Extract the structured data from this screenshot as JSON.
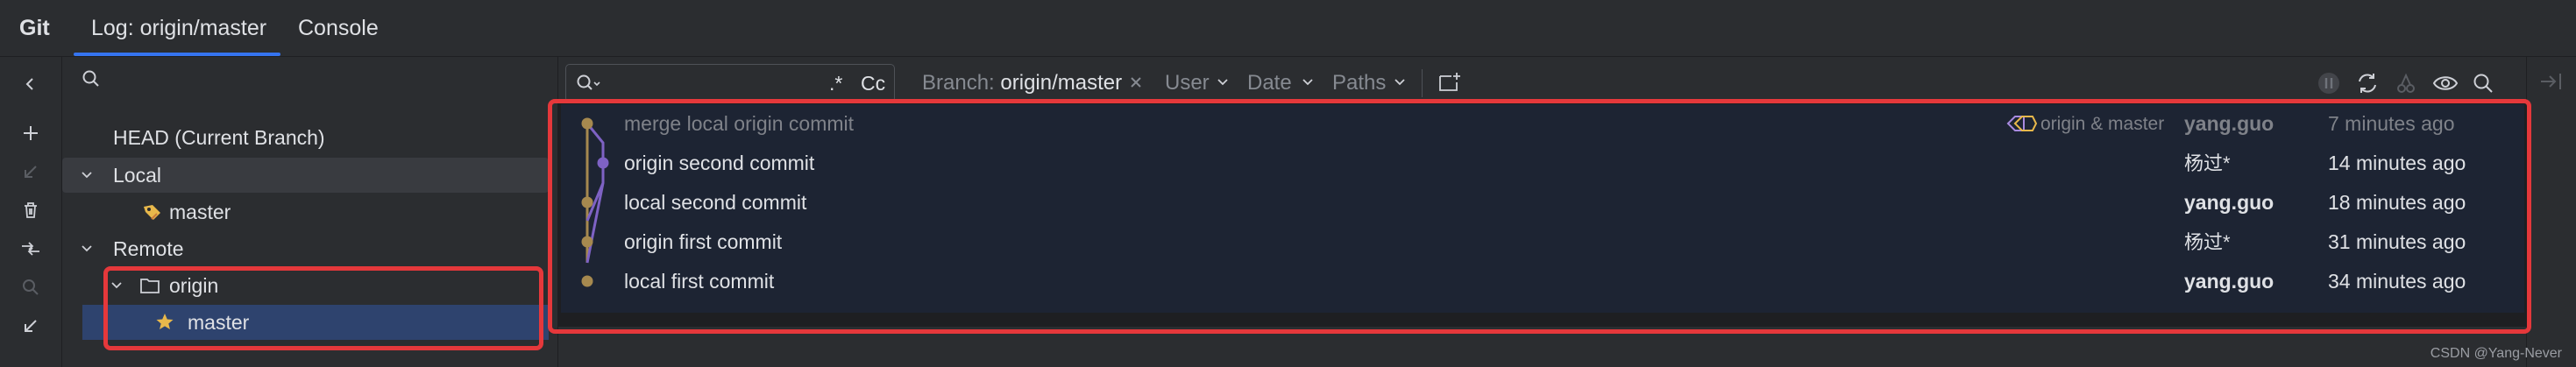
{
  "tabs": [
    {
      "label": "Git"
    },
    {
      "label": "Log: origin/master"
    },
    {
      "label": "Console"
    }
  ],
  "branches": {
    "head": "HEAD (Current Branch)",
    "local_group": "Local",
    "local_master": "master",
    "remote_group": "Remote",
    "remote_origin": "origin",
    "remote_master": "master"
  },
  "filters": {
    "regex": ".*",
    "case": "Cc",
    "branch_prefix": "Branch:",
    "branch_value": "origin/master",
    "user": "User",
    "date": "Date",
    "paths": "Paths"
  },
  "commits": [
    {
      "subject": "merge local origin commit",
      "refs": "origin & master",
      "author": "yang.guo",
      "date": "7 minutes ago"
    },
    {
      "subject": "origin second commit",
      "refs": "",
      "author": "杨过*",
      "date": "14 minutes ago"
    },
    {
      "subject": "local second commit",
      "refs": "",
      "author": "yang.guo",
      "date": "18 minutes ago"
    },
    {
      "subject": "origin first commit",
      "refs": "",
      "author": "杨过*",
      "date": "31 minutes ago"
    },
    {
      "subject": "local first commit",
      "refs": "",
      "author": "yang.guo",
      "date": "34 minutes ago"
    }
  ],
  "colors": {
    "accent": "#3574f0",
    "graph_gold": "#a6894f",
    "graph_purple": "#7e62c4",
    "highlight_box": "#e5383b"
  },
  "watermark": "CSDN @Yang-Never"
}
